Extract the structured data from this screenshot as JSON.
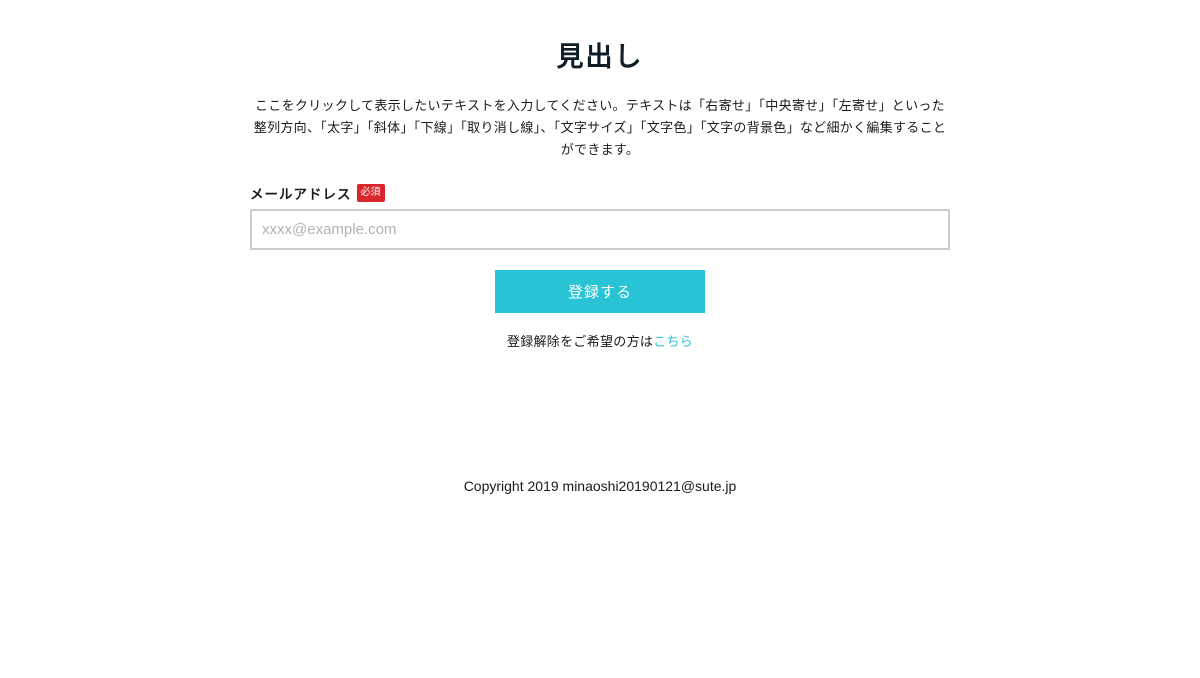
{
  "heading": "見出し",
  "description": "ここをクリックして表示したいテキストを入力してください。テキストは「右寄せ」「中央寄せ」「左寄せ」といった整列方向、「太字」「斜体」「下線」「取り消し線」、「文字サイズ」「文字色」「文字の背景色」など細かく編集することができます。",
  "form": {
    "email_label": "メールアドレス",
    "required_badge": "必須",
    "email_placeholder": "xxxx@example.com",
    "email_value": "",
    "submit_label": "登録する"
  },
  "unsubscribe": {
    "text": "登録解除をご希望の方は",
    "link_text": "こちら"
  },
  "footer": {
    "copyright": "Copyright 2019 minaoshi20190121@sute.jp"
  },
  "colors": {
    "accent": "#29c3d6",
    "required": "#d9262c",
    "heading": "#0f1e26",
    "input_border": "#cccccc"
  }
}
